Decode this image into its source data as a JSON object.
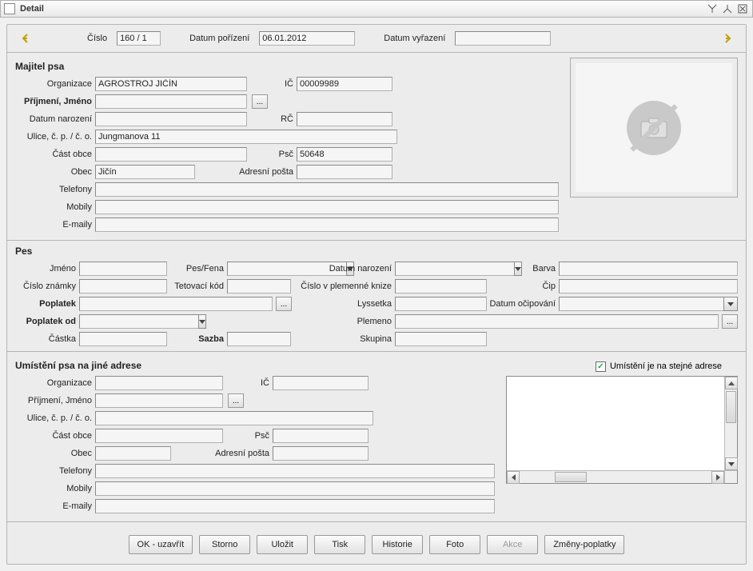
{
  "window": {
    "title": "Detail"
  },
  "top": {
    "cislo_label": "Číslo",
    "cislo": "160 / 1",
    "datum_porizeni_label": "Datum pořízení",
    "datum_porizeni": "06.01.2012",
    "datum_vyrazeni_label": "Datum vyřazení",
    "datum_vyrazeni": ""
  },
  "owner": {
    "section": "Majitel psa",
    "organizace_label": "Organizace",
    "organizace": "AGROSTROJ JIČÍN",
    "ic_label": "IČ",
    "ic": "00009989",
    "prijmeni_label": "Příjmení, Jméno",
    "prijmeni": "",
    "datum_nar_label": "Datum narození",
    "datum_nar": "",
    "rc_label": "RČ",
    "rc": "",
    "ulice_label": "Ulice, č. p. / č. o.",
    "ulice": "Jungmanova 11",
    "cast_obce_label": "Část obce",
    "cast_obce": "",
    "psc_label": "Psč",
    "psc": "50648",
    "obec_label": "Obec",
    "obec": "Jičín",
    "adr_posta_label": "Adresní pošta",
    "adr_posta": "",
    "telefony_label": "Telefony",
    "telefony": "",
    "mobily_label": "Mobily",
    "mobily": "",
    "emaily_label": "E-maily",
    "emaily": ""
  },
  "dog": {
    "section": "Pes",
    "jmeno_label": "Jméno",
    "jmeno": "",
    "pesfena_label": "Pes/Fena",
    "pesfena": "",
    "datum_nar_label": "Datum narození",
    "datum_nar": "",
    "barva_label": "Barva",
    "barva": "",
    "cislo_znamky_label": "Číslo známky",
    "cislo_znamky": "",
    "tetovaci_label": "Tetovací kód",
    "tetovaci": "",
    "plem_kniha_label": "Číslo v plemenné knize",
    "plem_kniha": "",
    "cip_label": "Čip",
    "cip": "",
    "poplatek_label": "Poplatek",
    "poplatek": "",
    "lyssetka_label": "Lyssetka",
    "lyssetka": "",
    "datum_ocip_label": "Datum očipování",
    "datum_ocip": "",
    "poplatek_od_label": "Poplatek od",
    "poplatek_od": "",
    "plemeno_label": "Plemeno",
    "plemeno": "",
    "castka_label": "Částka",
    "castka": "",
    "sazba_label": "Sazba",
    "sazba": "",
    "skupina_label": "Skupina",
    "skupina": ""
  },
  "loc": {
    "section": "Umístění psa na jiné adrese",
    "same_addr_label": "Umístění je na stejné adrese",
    "same_addr_checked": true,
    "organizace_label": "Organizace",
    "ic_label": "IČ",
    "prijmeni_label": "Příjmení, Jméno",
    "ulice_label": "Ulice, č. p. / č. o.",
    "cast_obce_label": "Část obce",
    "psc_label": "Psč",
    "obec_label": "Obec",
    "adr_posta_label": "Adresní pošta",
    "telefony_label": "Telefony",
    "mobily_label": "Mobily",
    "emaily_label": "E-maily"
  },
  "buttons": {
    "ok": "OK - uzavřít",
    "storno": "Storno",
    "ulozit": "Uložit",
    "tisk": "Tisk",
    "historie": "Historie",
    "foto": "Foto",
    "akce": "Akce",
    "zmeny": "Změny-poplatky"
  }
}
